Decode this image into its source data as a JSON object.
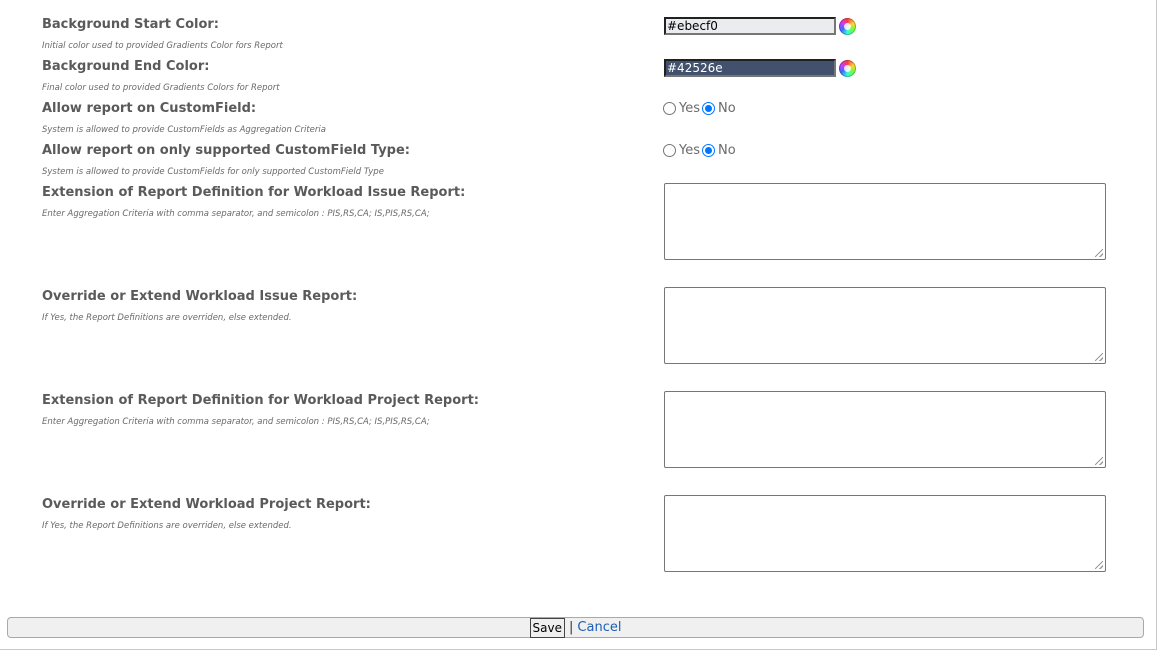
{
  "fields": {
    "bg_start": {
      "label": "Background Start Color:",
      "desc": "Initial color used to provided Gradients Color fors Report",
      "value": "#ebecf0"
    },
    "bg_end": {
      "label": "Background End Color:",
      "desc": "Final color used to provided Gradients Colors for Report",
      "value": "#42526e"
    },
    "allow_customfield": {
      "label": "Allow report on CustomField:",
      "desc": "System is allowed to provide CustomFields as Aggregation Criteria",
      "yes": "Yes",
      "no": "No",
      "selected": "No"
    },
    "allow_supported": {
      "label": "Allow report on only supported CustomField Type:",
      "desc": "System is allowed to provide CustomFields for only supported CustomField Type",
      "yes": "Yes",
      "no": "No",
      "selected": "No"
    },
    "ext_issue": {
      "label": "Extension of Report Definition for Workload Issue Report:",
      "desc": "Enter Aggregation Criteria with comma separator, and semicolon : PIS,RS,CA; IS,PIS,RS,CA;",
      "value": ""
    },
    "override_issue": {
      "label": "Override or Extend Workload Issue Report:",
      "desc": "If Yes, the Report Definitions are overriden, else extended.",
      "value": ""
    },
    "ext_project": {
      "label": "Extension of Report Definition for Workload Project Report:",
      "desc": "Enter Aggregation Criteria with comma separator, and semicolon : PIS,RS,CA; IS,PIS,RS,CA;",
      "value": ""
    },
    "override_project": {
      "label": "Override or Extend Workload Project Report:",
      "desc": "If Yes, the Report Definitions are overriden, else extended.",
      "value": ""
    }
  },
  "footer": {
    "save_label": "Save",
    "separator": "|",
    "cancel_label": "Cancel"
  },
  "colors": {
    "start_swatch": "#ebecf0",
    "end_swatch": "#42526e",
    "accent": "#0075ff",
    "link": "#1a5fb4"
  }
}
